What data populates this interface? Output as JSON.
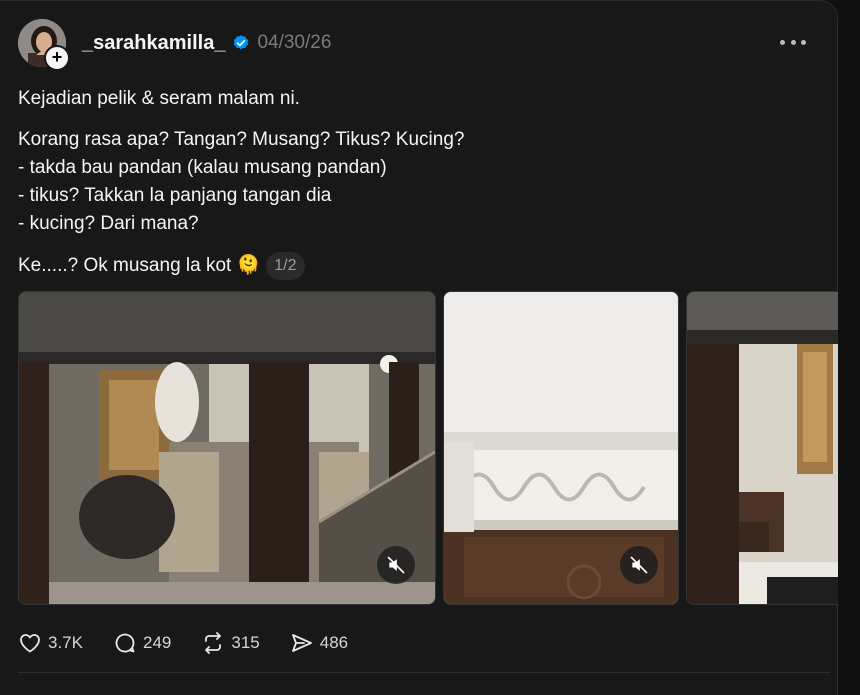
{
  "post": {
    "username": "_sarahkamilla_",
    "date": "04/30/26",
    "line1": "Kejadian pelik & seram malam ni.",
    "line2": "Korang rasa apa? Tangan? Musang? Tikus? Kucing?",
    "line3": "- takda bau pandan (kalau musang pandan)",
    "line4": "- tikus? Takkan la panjang tangan dia",
    "line5": "- kucing? Dari mana?",
    "line6": "Ke.....? Ok musang la kot 🫠",
    "pager": "1/2"
  },
  "icons": {
    "verified": "verified-badge-icon",
    "more": "more-options-icon",
    "like": "heart-icon",
    "reply": "comment-bubble-icon",
    "repost": "repost-icon",
    "share": "share-send-icon",
    "mute": "muted-speaker-icon",
    "follow": "plus-icon"
  },
  "actions": {
    "likes": "3.7K",
    "replies": "249",
    "reposts": "315",
    "shares": "486"
  },
  "colors": {
    "background": "#181818",
    "verified": "#0095f6",
    "muted_text": "#7a7a7a"
  }
}
